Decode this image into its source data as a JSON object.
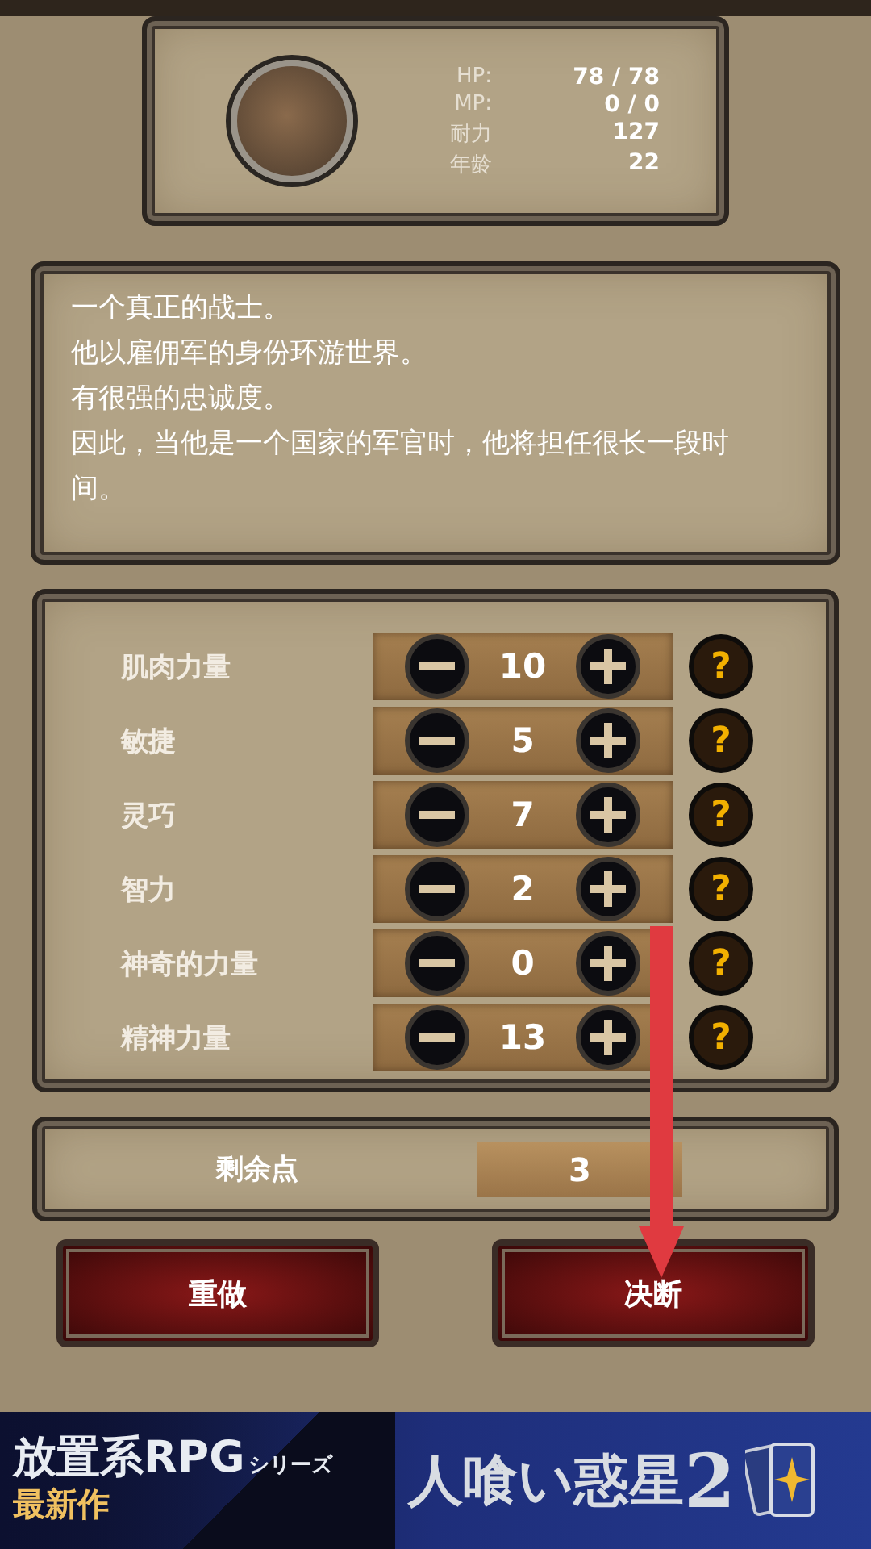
{
  "character": {
    "stats": [
      {
        "label": "HP:",
        "value": "78 / 78"
      },
      {
        "label": "MP:",
        "value": "0 / 0"
      },
      {
        "label": "耐力",
        "value": "127"
      },
      {
        "label": "年龄",
        "value": "22"
      }
    ]
  },
  "description": [
    "一个真正的战士。",
    "他以雇佣军的身份环游世界。",
    "有很强的忠诚度。",
    "因此，当他是一个国家的军官时，他将担任很长一段时间。"
  ],
  "attributes": [
    {
      "label": "肌肉力量",
      "value": "10",
      "help": "?"
    },
    {
      "label": "敏捷",
      "value": "5",
      "help": "?"
    },
    {
      "label": "灵巧",
      "value": "7",
      "help": "?"
    },
    {
      "label": "智力",
      "value": "2",
      "help": "?"
    },
    {
      "label": "神奇的力量",
      "value": "0",
      "help": "?"
    },
    {
      "label": "精神力量",
      "value": "13",
      "help": "?"
    }
  ],
  "remaining": {
    "label": "剩余点",
    "value": "3"
  },
  "buttons": [
    {
      "label": "重做"
    },
    {
      "label": "决断"
    }
  ],
  "banner": {
    "series": "放置系RPG",
    "series_suffix": "シリーズ",
    "tag": "最新作",
    "title": "人喰い惑星",
    "title_number": "2"
  }
}
